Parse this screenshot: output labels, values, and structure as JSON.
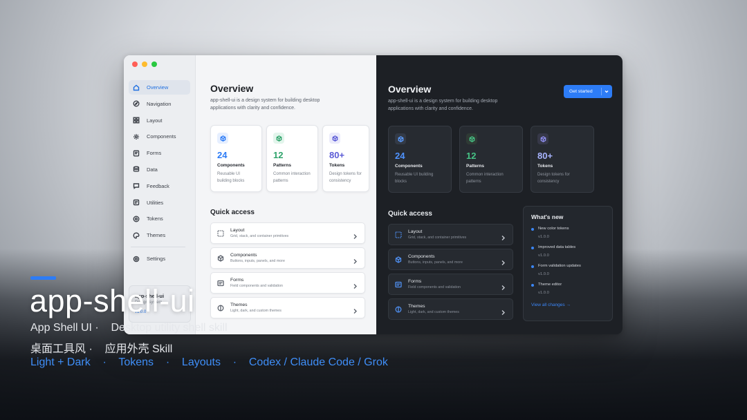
{
  "window": {
    "sidebar": {
      "items": [
        {
          "label": "Overview",
          "icon": "home-icon",
          "active": true
        },
        {
          "label": "Navigation",
          "icon": "compass-icon"
        },
        {
          "label": "Layout",
          "icon": "grid-icon"
        },
        {
          "label": "Components",
          "icon": "gear-icon"
        },
        {
          "label": "Forms",
          "icon": "form-icon"
        },
        {
          "label": "Data",
          "icon": "database-icon"
        },
        {
          "label": "Feedback",
          "icon": "message-icon"
        },
        {
          "label": "Utilities",
          "icon": "wrench-icon"
        },
        {
          "label": "Tokens",
          "icon": "target-icon"
        },
        {
          "label": "Themes",
          "icon": "palette-icon"
        }
      ],
      "settings_label": "Settings",
      "card": {
        "title": "app-shell-ui",
        "subtitle": "Design system",
        "version": "v1.0.0"
      }
    },
    "overview": {
      "title": "Overview",
      "description": "app-shell-ui is a design system for building desktop applications with clarity and confidence."
    },
    "get_started_label": "Get started",
    "stats": [
      {
        "value": "24",
        "label": "Components",
        "desc": "Reusable UI building blocks",
        "color": "#2d7cf6"
      },
      {
        "value": "12",
        "label": "Patterns",
        "desc": "Common interaction patterns",
        "color": "#2fa36b"
      },
      {
        "value": "80+",
        "label": "Tokens",
        "desc": "Design tokens for consistency",
        "color": "#5b5bd6"
      }
    ],
    "quick_access": {
      "title": "Quick access",
      "items": [
        {
          "title": "Layout",
          "desc": "Grid, stack, and container primitives"
        },
        {
          "title": "Components",
          "desc": "Buttons, inputs, panels, and more"
        },
        {
          "title": "Forms",
          "desc": "Field components and validation"
        },
        {
          "title": "Themes",
          "desc": "Light, dark, and custom themes"
        }
      ]
    },
    "whats_new": {
      "title": "What's new",
      "items": [
        {
          "name": "New color tokens",
          "version": "v1.0.0"
        },
        {
          "name": "Improved data tables",
          "version": "v1.0.0"
        },
        {
          "name": "Form validation updates",
          "version": "v1.0.0"
        },
        {
          "name": "Theme editor",
          "version": "v1.0.0"
        }
      ],
      "link": "View all changes →"
    }
  },
  "brand": {
    "title": "app-shell-ui",
    "line1": [
      "App Shell UI ·",
      "Desktop utility shell skill"
    ],
    "line2": [
      "桌面工具风 ·",
      "应用外壳 Skill"
    ],
    "line3": [
      "Light + Dark",
      "·",
      "Tokens",
      "·",
      "Layouts",
      "·",
      "Codex / Claude Code / Grok"
    ]
  },
  "colors": {
    "accent": "#2d7cf6",
    "light_bg": "#f4f5f7",
    "dark_bg": "#1d2025"
  }
}
